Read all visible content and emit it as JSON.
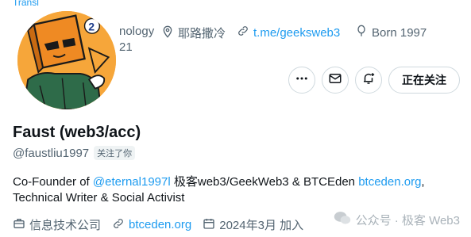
{
  "header": {
    "translate_label": "Transl",
    "profession_partial": "nology",
    "location": "耶路撒冷",
    "website": "t.me/geeksweb3",
    "born": "Born 1997",
    "joined_partial": "21"
  },
  "actions": {
    "more_icon": "ellipsis-icon",
    "message_icon": "mail-icon",
    "notify_icon": "bell-plus-icon",
    "follow_label": "正在关注"
  },
  "profile": {
    "name": "Faust (web3/acc)",
    "handle": "@faustliu1997",
    "follows_you": "关注了你"
  },
  "bio": {
    "part1": "Co-Founder of ",
    "mention": "@eternal1997l",
    "part2": " 极客web3/GeekWeb3 & BTCEden ",
    "link": "btceden.org",
    "part3": ",",
    "line2": "Technical Writer & Social Activist"
  },
  "meta": {
    "category": "信息技术公司",
    "website": "btceden.org",
    "joined": "2024年3月 加入"
  },
  "watermark": {
    "text": "公众号 · 极客 Web3"
  },
  "colors": {
    "accent": "#1d9bf0",
    "muted": "#536471",
    "avatar_bg": "#f6a63a"
  }
}
